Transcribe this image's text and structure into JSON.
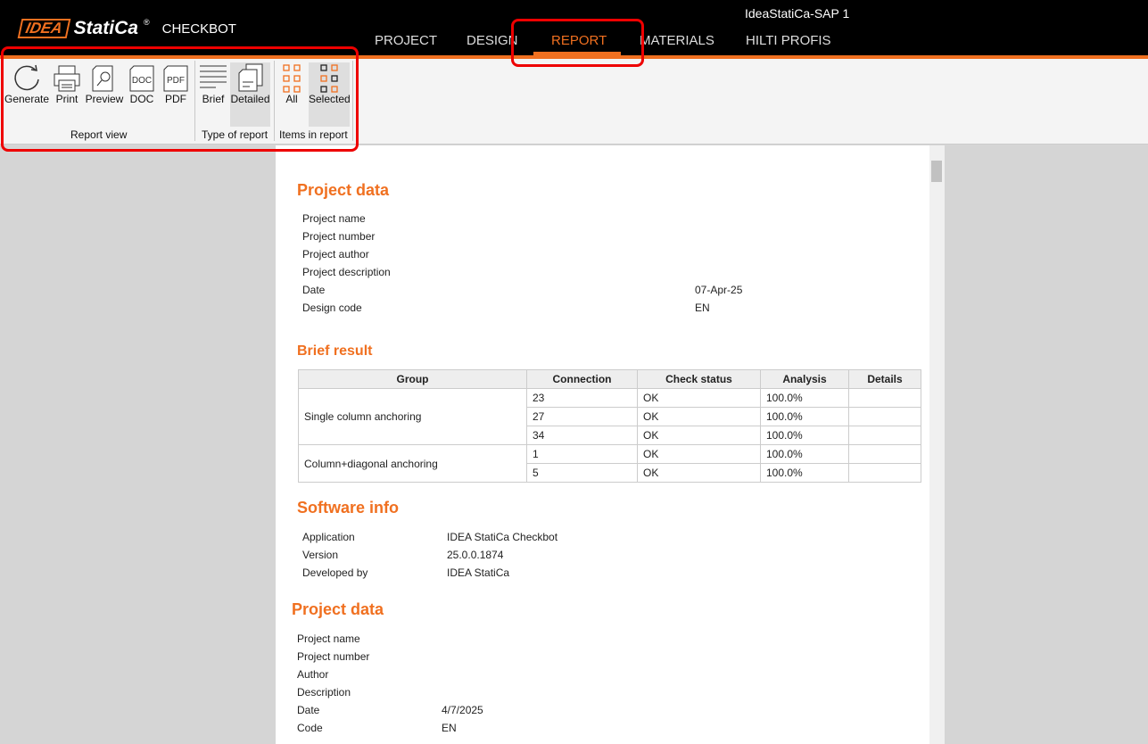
{
  "window_title": "IdeaStatiCa-SAP 1",
  "logo": {
    "brand1": "IDEA",
    "brand2": "StatiCa",
    "reg": "®",
    "product": "CHECKBOT"
  },
  "tabs": [
    "PROJECT",
    "DESIGN",
    "REPORT",
    "MATERIALS",
    "HILTI PROFIS"
  ],
  "active_tab": "REPORT",
  "ribbon": {
    "report_view": {
      "label": "Report view",
      "buttons": [
        "Generate",
        "Print",
        "Preview",
        "DOC",
        "PDF"
      ]
    },
    "type_of_report": {
      "label": "Type of report",
      "buttons": [
        "Brief",
        "Detailed"
      ],
      "selected": "Detailed"
    },
    "items_in_report": {
      "label": "Items in report",
      "buttons": [
        "All",
        "Selected"
      ],
      "selected": "Selected"
    },
    "doc_icon_text": "DOC",
    "pdf_icon_text": "PDF"
  },
  "report": {
    "project_data_title": "Project data",
    "project_data": [
      [
        "Project name",
        ""
      ],
      [
        "Project number",
        ""
      ],
      [
        "Project author",
        ""
      ],
      [
        "Project description",
        ""
      ],
      [
        "Date",
        "07-Apr-25"
      ],
      [
        "Design code",
        "EN"
      ]
    ],
    "brief_result_title": "Brief result",
    "columns": [
      "Group",
      "Connection",
      "Check status",
      "Analysis",
      "Details"
    ],
    "groups": [
      {
        "name": "Single column anchoring",
        "rows": [
          [
            "23",
            "OK",
            "100.0%",
            ""
          ],
          [
            "27",
            "OK",
            "100.0%",
            ""
          ],
          [
            "34",
            "OK",
            "100.0%",
            ""
          ]
        ]
      },
      {
        "name": "Column+diagonal anchoring",
        "rows": [
          [
            "1",
            "OK",
            "100.0%",
            ""
          ],
          [
            "5",
            "OK",
            "100.0%",
            ""
          ]
        ]
      }
    ],
    "software_title": "Software info",
    "software": [
      [
        "Application",
        "IDEA StatiCa Checkbot"
      ],
      [
        "Version",
        "25.0.0.1874"
      ],
      [
        "Developed by",
        "IDEA StatiCa"
      ]
    ],
    "project_data2_title": "Project data",
    "project_data2": [
      [
        "Project name",
        ""
      ],
      [
        "Project number",
        ""
      ],
      [
        "Author",
        ""
      ],
      [
        "Description",
        ""
      ],
      [
        "Date",
        "4/7/2025"
      ],
      [
        "Code",
        "EN"
      ]
    ]
  }
}
